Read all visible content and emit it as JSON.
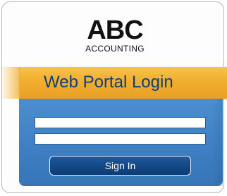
{
  "logo": {
    "main": "ABC",
    "sub": "ACCOUNTING"
  },
  "banner": {
    "title": "Web Portal Login"
  },
  "form": {
    "username_value": "",
    "password_value": "",
    "signin_label": "Sign In"
  },
  "colors": {
    "banner_orange": "#f1ae2e",
    "panel_blue": "#3d7fc2",
    "title_blue": "#0f3f78",
    "button_navy": "#134784"
  }
}
